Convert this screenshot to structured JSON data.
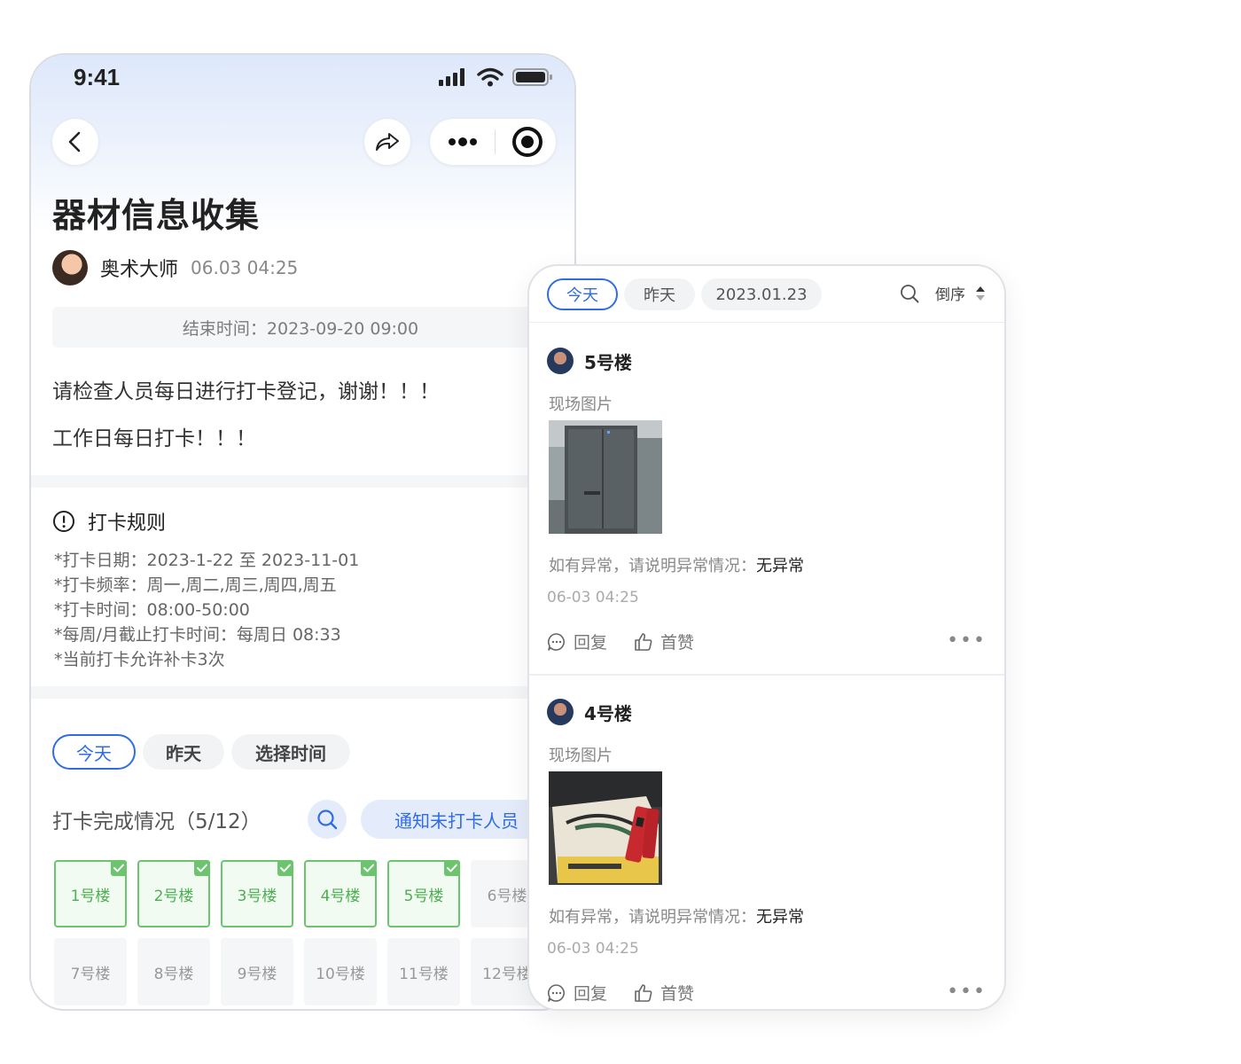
{
  "status_bar": {
    "time": "9:41"
  },
  "page": {
    "title": "器材信息收集",
    "author_name": "奥术大师",
    "author_time": "06.03 04:25",
    "end_time": "结束时间：2023-09-20 09:00",
    "notice_lines": [
      "请检查人员每日进行打卡登记，谢谢！！！",
      "工作日每日打卡！！！"
    ]
  },
  "rules": {
    "title": "打卡规则",
    "lines": [
      "*打卡日期：2023-1-22 至 2023-11-01",
      "*打卡频率：周一,周二,周三,周四,周五",
      "*打卡时间：08:00-50:00",
      "*每周/月截止打卡时间：每周日 08:33",
      "*当前打卡允许补卡3次"
    ]
  },
  "checkin_tabs": [
    "今天",
    "昨天",
    "选择时间"
  ],
  "stats": {
    "title": "打卡完成情况（5/12）",
    "notify_label": "通知未打卡人员"
  },
  "buildings": [
    {
      "label": "1号楼",
      "done": true
    },
    {
      "label": "2号楼",
      "done": true
    },
    {
      "label": "3号楼",
      "done": true
    },
    {
      "label": "4号楼",
      "done": true
    },
    {
      "label": "5号楼",
      "done": true
    },
    {
      "label": "6号楼",
      "done": false
    },
    {
      "label": "7号楼",
      "done": false
    },
    {
      "label": "8号楼",
      "done": false
    },
    {
      "label": "9号楼",
      "done": false
    },
    {
      "label": "10号楼",
      "done": false
    },
    {
      "label": "11号楼",
      "done": false
    },
    {
      "label": "12号楼",
      "done": false
    }
  ],
  "feed": {
    "tabs": [
      "今天",
      "昨天",
      "2023.01.23"
    ],
    "sort_label": "倒序",
    "posts": [
      {
        "author": "5号楼",
        "field_label": "现场图片",
        "abnormal_label": "如有异常，请说明异常情况：",
        "abnormal_value": "无异常",
        "time": "06-03 04:25",
        "reply_label": "回复",
        "like_label": "首赞"
      },
      {
        "author": "4号楼",
        "field_label": "现场图片",
        "abnormal_label": "如有异常，请说明异常情况：",
        "abnormal_value": "无异常",
        "time": "06-03 04:25",
        "reply_label": "回复",
        "like_label": "首赞"
      }
    ]
  },
  "colors": {
    "accent": "#2f6ce5",
    "done_green": "#6cc46f"
  }
}
